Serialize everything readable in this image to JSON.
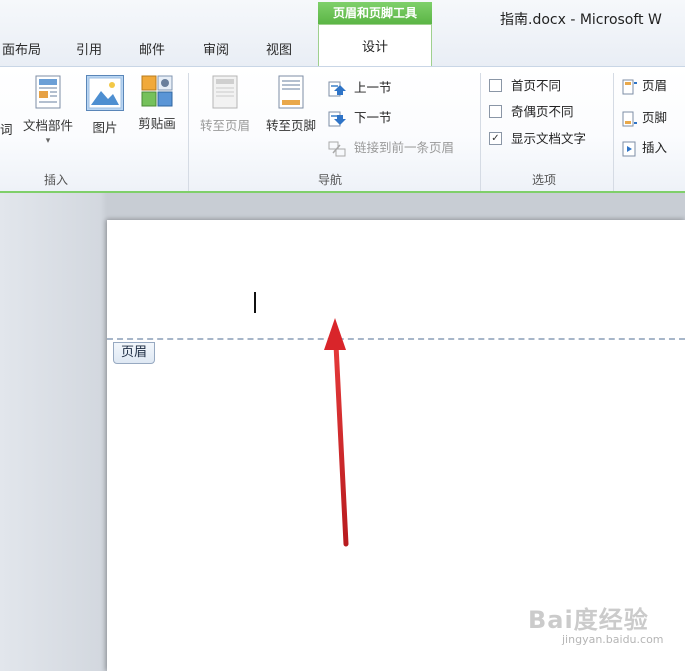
{
  "window": {
    "title": "指南.docx - Microsoft W"
  },
  "tabs": [
    {
      "label": "页面布局",
      "shown": "面布局"
    },
    {
      "label": "引用"
    },
    {
      "label": "邮件"
    },
    {
      "label": "审阅"
    },
    {
      "label": "视图"
    }
  ],
  "context_tab": {
    "group_title": "页眉和页脚工具",
    "active_label": "设计"
  },
  "groups": {
    "insert": {
      "label": "插入",
      "partial_left": "词",
      "buttons": [
        {
          "label": "文档部件",
          "icon": "quick-parts-icon"
        },
        {
          "label": "图片",
          "icon": "picture-icon"
        },
        {
          "label": "剪贴画",
          "icon": "clip-art-icon"
        }
      ]
    },
    "navigation": {
      "label": "导航",
      "goto_header": "转至页眉",
      "goto_footer": "转至页脚",
      "prev_section": "上一节",
      "next_section": "下一节",
      "link_previous": "链接到前一条页眉"
    },
    "options": {
      "label": "选项",
      "first_page": {
        "label": "首页不同",
        "checked": false
      },
      "odd_even": {
        "label": "奇偶页不同",
        "checked": false
      },
      "show_text": {
        "label": "显示文档文字",
        "checked": true
      }
    },
    "position": {
      "header": "页眉",
      "footer": "页脚",
      "insert": "插入"
    }
  },
  "document": {
    "header_tag": "页眉"
  },
  "annotation": {
    "arrow_color": "#d9252a"
  },
  "watermark": {
    "logo": "Bai度经验",
    "url": "jingyan.baidu.com"
  },
  "colors": {
    "context_green": "#5bb545",
    "ribbon_border": "#7fcf6a",
    "header_dash": "#a7b6c9"
  }
}
